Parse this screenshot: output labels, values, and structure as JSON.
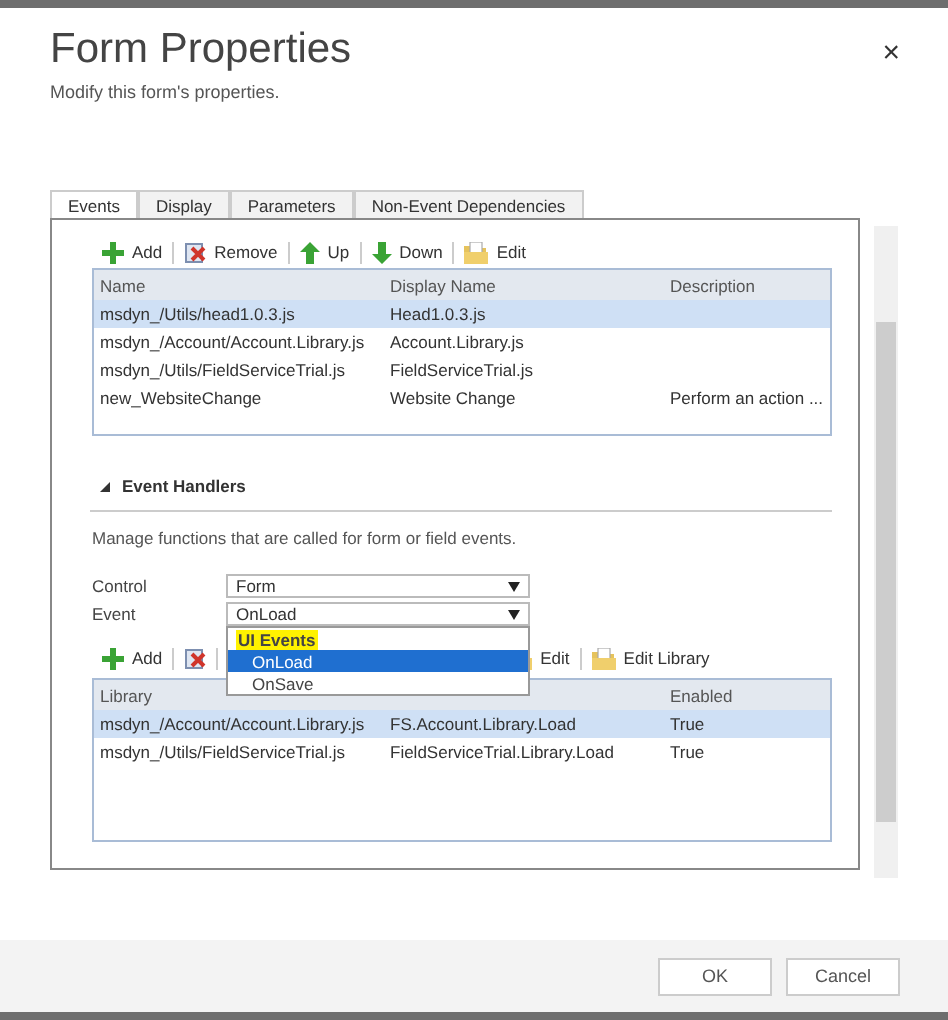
{
  "dialog": {
    "title": "Form Properties",
    "subtitle": "Modify this form's properties.",
    "close": "×"
  },
  "tabs": [
    {
      "label": "Events",
      "selected": true
    },
    {
      "label": "Display",
      "selected": false
    },
    {
      "label": "Parameters",
      "selected": false
    },
    {
      "label": "Non-Event Dependencies",
      "selected": false
    }
  ],
  "libraries": {
    "toolbar": [
      {
        "label": "Add"
      },
      {
        "label": "Remove"
      },
      {
        "label": "Up"
      },
      {
        "label": "Down"
      },
      {
        "label": "Edit"
      }
    ],
    "columns": [
      "Name",
      "Display Name",
      "Description"
    ],
    "rows": [
      {
        "cells": [
          "msdyn_/Utils/head1.0.3.js",
          "Head1.0.3.js"
        ],
        "selected": true
      },
      {
        "cells": [
          "msdyn_/Account/Account.Library.js",
          "Account.Library.js"
        ],
        "selected": false
      },
      {
        "cells": [
          "msdyn_/Utils/FieldServiceTrial.js",
          "FieldServiceTrial.js"
        ],
        "selected": false
      },
      {
        "cells": [
          "new_WebsiteChange",
          "Website Change",
          "Perform an action ..."
        ],
        "selected": false
      }
    ]
  },
  "event_handlers": {
    "heading": "Event Handlers",
    "expanded": true,
    "description": "Manage functions that are called for form or field events.",
    "control": {
      "label": "Control",
      "value": "Form"
    },
    "event": {
      "label": "Event",
      "value": "OnLoad",
      "open": true,
      "options": [
        {
          "kind": "group",
          "label": "UI Events"
        },
        {
          "kind": "option",
          "label": "OnLoad",
          "selected": true
        },
        {
          "kind": "option",
          "label": "OnSave",
          "selected": false
        }
      ]
    },
    "toolbar": [
      {
        "label": "Add"
      },
      {
        "label": "Edit"
      },
      {
        "label": "Edit Library"
      }
    ],
    "columns": [
      "Library",
      null,
      "Enabled"
    ],
    "rows": [
      {
        "cells": [
          "msdyn_/Account/Account.Library.js",
          "FS.Account.Library.Load",
          "True"
        ],
        "selected": true
      },
      {
        "cells": [
          "msdyn_/Utils/FieldServiceTrial.js",
          "FieldServiceTrial.Library.Load",
          "True"
        ],
        "selected": false
      }
    ]
  },
  "buttons": [
    "OK",
    "Cancel"
  ]
}
